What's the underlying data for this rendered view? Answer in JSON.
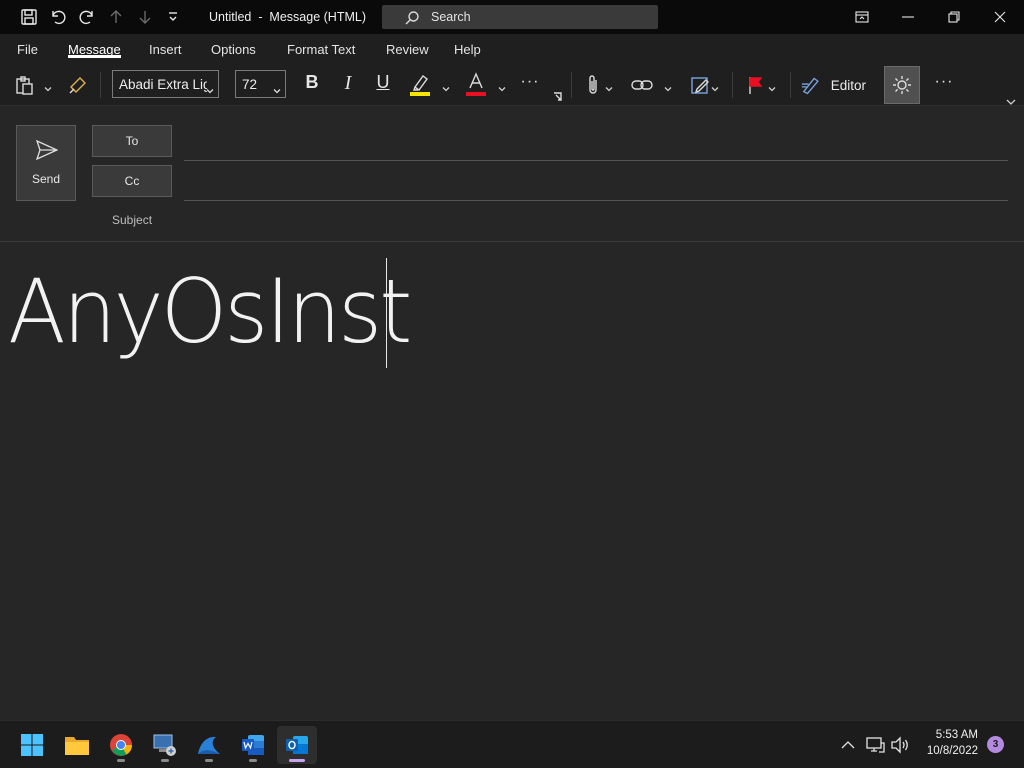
{
  "titlebar": {
    "title": "Untitled  -  Message (HTML)",
    "search_label": "Search"
  },
  "tabs": [
    "File",
    "Message",
    "Insert",
    "Options",
    "Format Text",
    "Review",
    "Help"
  ],
  "active_tab": "Message",
  "ribbon": {
    "font_name": "Abadi Extra Lig",
    "font_size": "72",
    "bold": "B",
    "italic": "I",
    "underline": "U",
    "font_color_letter": "A",
    "more": "···",
    "editor_label": "Editor",
    "highlight_color": "#f5e500",
    "font_color": "#e81123",
    "flag_color": "#e81123"
  },
  "compose": {
    "send_label": "Send",
    "to_label": "To",
    "cc_label": "Cc",
    "subject_label": "Subject"
  },
  "body": {
    "text": "AnyOsInst"
  },
  "taskbar": {
    "apps": [
      "start-icon",
      "file-explorer-icon",
      "chrome-icon",
      "remote-desktop-icon",
      "edge-beta-icon",
      "word-icon",
      "outlook-icon"
    ],
    "time": "5:53 AM",
    "date": "10/8/2022",
    "notification_count": "3"
  }
}
